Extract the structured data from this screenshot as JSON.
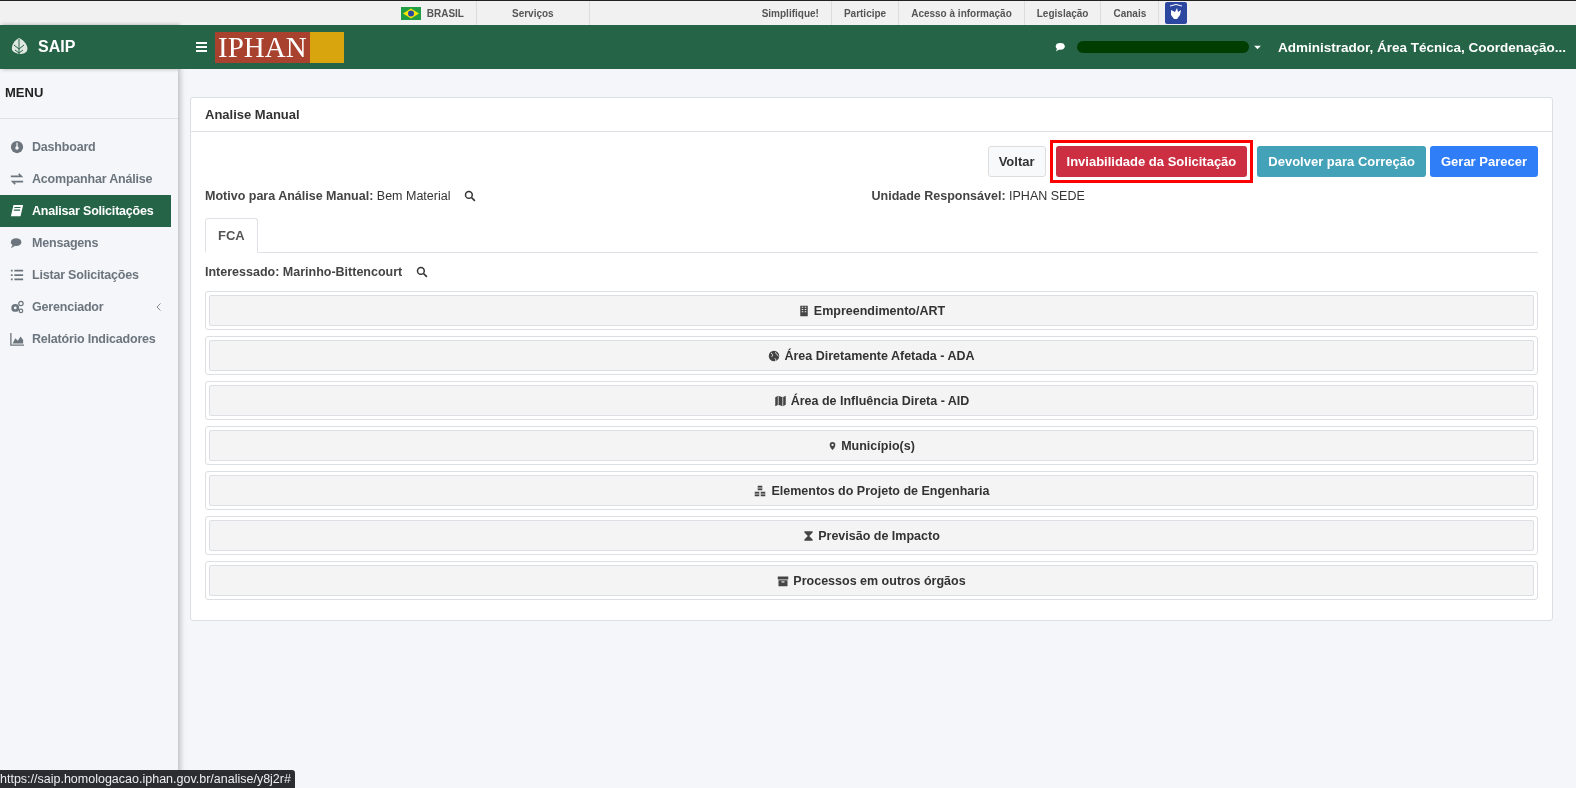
{
  "gov_bar": {
    "country": "BRASIL",
    "links": [
      "Serviços",
      "Simplifique!",
      "Participe",
      "Acesso à informação",
      "Legislação",
      "Canais"
    ]
  },
  "header": {
    "brand": "SAIP",
    "logo": "IPHAN",
    "user_roles": "Administrador, Área Técnica, Coordenação..."
  },
  "sidebar": {
    "title": "MENU",
    "items": [
      {
        "label": "Dashboard",
        "selected": false
      },
      {
        "label": "Acompanhar Análise",
        "selected": false
      },
      {
        "label": "Analisar Solicitações",
        "selected": true
      },
      {
        "label": "Mensagens",
        "selected": false
      },
      {
        "label": "Listar Solicitações",
        "selected": false
      },
      {
        "label": "Gerenciador",
        "selected": false,
        "has_submenu": true
      },
      {
        "label": "Relatório Indicadores",
        "selected": false
      }
    ]
  },
  "card": {
    "title": "Analise Manual",
    "buttons": [
      {
        "label": "Voltar",
        "kind": "light",
        "highlighted": false
      },
      {
        "label": "Inviabilidade da Solicitação",
        "kind": "danger",
        "highlighted": true
      },
      {
        "label": "Devolver para Correção",
        "kind": "info",
        "highlighted": false
      },
      {
        "label": "Gerar Parecer",
        "kind": "primary",
        "highlighted": false
      }
    ],
    "motivo": {
      "label": "Motivo para Análise Manual:",
      "value": "Bem Material"
    },
    "unidade": {
      "label": "Unidade Responsável:",
      "value": "IPHAN SEDE"
    },
    "tabs": [
      {
        "label": "FCA",
        "selected": true
      }
    ],
    "interessado": "Interessado: Marinho-Bittencourt",
    "sections": [
      "Empreendimento/ART",
      "Área Diretamente Afetada - ADA",
      "Área de Influência Direta - AID",
      "Município(s)",
      "Elementos do Projeto de Engenharia",
      "Previsão de Impacto",
      "Processos em outros órgãos"
    ]
  },
  "status_url": "https://saip.homologacao.iphan.gov.br/analise/y8j2r#"
}
